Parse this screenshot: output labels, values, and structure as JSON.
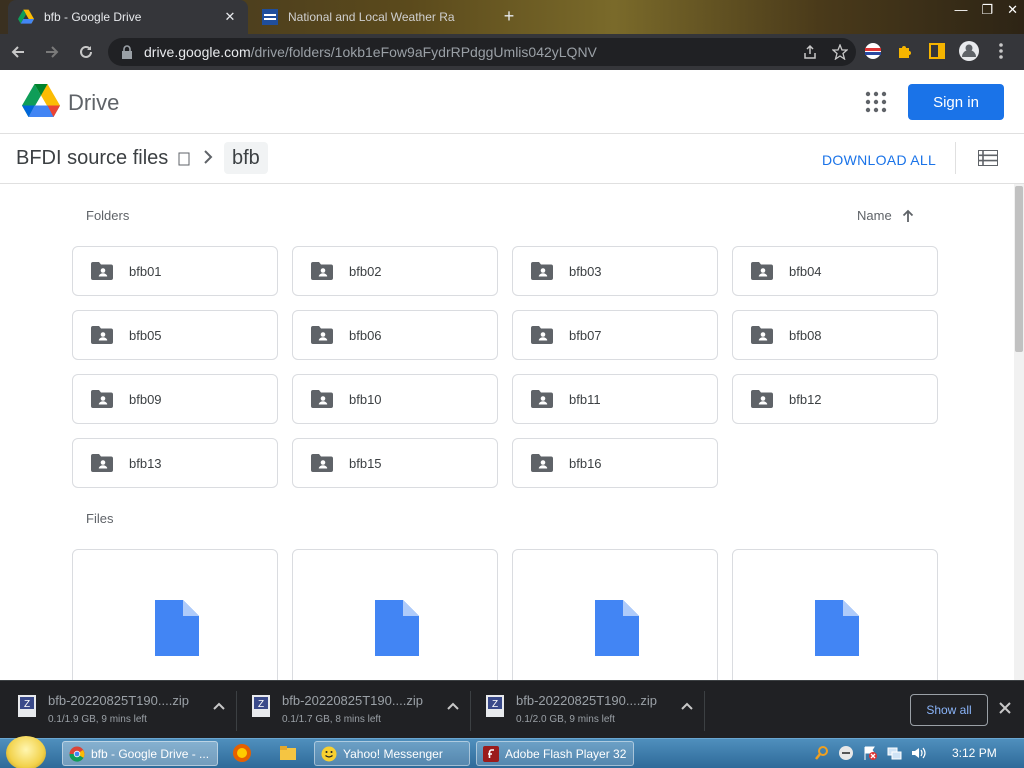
{
  "browser": {
    "tabs": [
      {
        "title": "bfb - Google Drive",
        "active": true
      },
      {
        "title": "National and Local Weather Ra",
        "active": false
      }
    ],
    "url_host": "drive.google.com",
    "url_path": "/drive/folders/1okb1eFow9aFydrRPdggUmlis042yLQNV"
  },
  "drive": {
    "product": "Drive",
    "sign_in": "Sign in",
    "breadcrumb_root": "BFDI source files",
    "breadcrumb_current": "bfb",
    "download_all": "DOWNLOAD ALL",
    "folders_label": "Folders",
    "files_label": "Files",
    "sort_label": "Name",
    "folders": [
      "bfb01",
      "bfb02",
      "bfb03",
      "bfb04",
      "bfb05",
      "bfb06",
      "bfb07",
      "bfb08",
      "bfb09",
      "bfb10",
      "bfb11",
      "bfb12",
      "bfb13",
      "bfb15",
      "bfb16"
    ],
    "file_count_visible": 4,
    "colors": {
      "accent": "#1a73e8",
      "doc": "#4285f4"
    }
  },
  "downloads": {
    "items": [
      {
        "name": "bfb-20220825T190....zip",
        "status": "0.1/1.9 GB, 9 mins left"
      },
      {
        "name": "bfb-20220825T190....zip",
        "status": "0.1/1.7 GB, 8 mins left"
      },
      {
        "name": "bfb-20220825T190....zip",
        "status": "0.1/2.0 GB, 9 mins left"
      }
    ],
    "show_all": "Show all"
  },
  "taskbar": {
    "items": [
      {
        "label": "bfb - Google Drive - ..."
      },
      {
        "label": "Yahoo! Messenger"
      },
      {
        "label": "Adobe Flash Player 32"
      }
    ],
    "clock": "3:12 PM"
  }
}
